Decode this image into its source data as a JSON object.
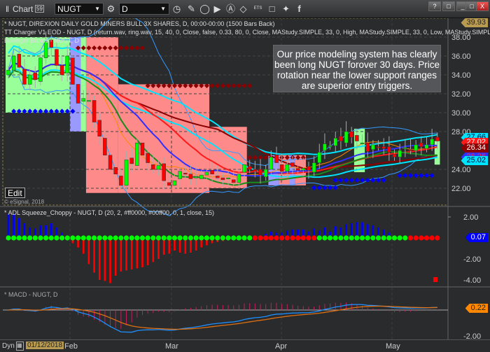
{
  "toolbar": {
    "title": "Chart",
    "symbol": "NUGT",
    "interval": "D",
    "window_buttons": [
      "?",
      "□",
      "_",
      "□",
      "X"
    ],
    "icons": [
      "link-icon",
      "settings-icon",
      "clock-icon",
      "pencil-icon",
      "draw-icon",
      "play-icon",
      "alert-icon",
      "tag-icon",
      "ets-icon",
      "comment-icon",
      "twitter-icon",
      "facebook-icon"
    ],
    "ets": "ETS"
  },
  "price_pane": {
    "line1": "* NUGT, DIREXION DAILY GOLD MINERS BULL 3X SHARES, D, 00:00-00:00 (1500 Bars Back)",
    "line2": "TT Charger V1 EOD - NUGT, D (return.wav, ring.wav, 15, 40, 0, Close, false, 0.33, 80, 0, Close, MAStudy.SIMPLE, 33, 0, High, MAStudy.SIMPLE, 33, 0, Low, MAStudy.SIMPLE, 14",
    "line3": "Bollinger Bands - NUGT, D",
    "note": "Our price modeling system has clearly been long NUGT forover 30 days. Price rotation near the lower support ranges are superior entry triggers.",
    "edit": "Edit",
    "copyright": "© eSignal, 2018",
    "axis": [
      "38.00",
      "36.00",
      "34.00",
      "32.00",
      "30.00",
      "28.00",
      "24.00",
      "22.00"
    ],
    "tags": [
      {
        "v": "39.93",
        "bg": "#b89a50",
        "fg": "#222"
      },
      {
        "v": "27.66",
        "bg": "#00e5ff",
        "fg": "#003"
      },
      {
        "v": "27.02",
        "bg": "#ff1a1a",
        "fg": "#fff"
      },
      {
        "v": "26.34",
        "bg": "#8b0000",
        "fg": "#fff"
      },
      {
        "v": "26.26",
        "bg": "#3030ff",
        "fg": "#f33"
      },
      {
        "v": "25.02",
        "bg": "#00e5ff",
        "fg": "#003"
      }
    ]
  },
  "squeeze_pane": {
    "title": "* ADL Squeeze_Choppy - NUGT, D (20, 2, #ff0000, #00ff00, 0, 1, close, 15)",
    "axis": [
      "2.00",
      "-2.00",
      "-4.00"
    ],
    "tag": "0.07"
  },
  "macd_pane": {
    "title": "* MACD - NUGT, D",
    "axis": [
      "-2.00"
    ],
    "tag": "0.22"
  },
  "bottom": {
    "dyn": "Dyn",
    "date": "01/12/2018",
    "months": [
      "Feb",
      "Mar",
      "Apr",
      "May"
    ]
  },
  "colors": {
    "up": "#00ff00",
    "down": "#ff0000",
    "bg": "#2a2b2d"
  },
  "chart_data": {
    "type": "candlestick",
    "symbol": "NUGT",
    "ylim": [
      21,
      40
    ],
    "closes": [
      34.5,
      36,
      34.8,
      33,
      34,
      33.5,
      35.8,
      37.5,
      36.9,
      35,
      34,
      36,
      33,
      31,
      31.5,
      31.3,
      29,
      27.5,
      25.5,
      24,
      23.5,
      22.3,
      25,
      24.6,
      26.8,
      25.5,
      24.7,
      24,
      24.4,
      22.8,
      22.3,
      22.8,
      23.8,
      23.5,
      23,
      23.2,
      23.4,
      23.7,
      23.5,
      23.1,
      22.9,
      23.1,
      22.6,
      23.5,
      24.5,
      24,
      23.8,
      23.4,
      24,
      25.3,
      24.7,
      23.8,
      24.5,
      24.3,
      23.9,
      24.1,
      23.9,
      24.7,
      25.8,
      26.7,
      26.5,
      27.3,
      27.0,
      28.0,
      27.4,
      27.0,
      26.8,
      25.9,
      26.6,
      26.4,
      26.2,
      25.8,
      25.3,
      26.0,
      26.3,
      26.0,
      26.6,
      26.4,
      26.6,
      27.2,
      27.0
    ],
    "zones": [
      {
        "from": 0,
        "to": 12,
        "color": "#99ff99",
        "top": 38,
        "bottom": 30
      },
      {
        "from": 12,
        "to": 14,
        "color": "#9999ff",
        "top": 38,
        "bottom": 28
      },
      {
        "from": 14,
        "to": 15,
        "color": "#99ff99",
        "top": 38,
        "bottom": 28
      },
      {
        "from": 15,
        "to": 21,
        "color": "#ff8a8a",
        "top": 38,
        "bottom": 21.5
      },
      {
        "from": 21,
        "to": 38,
        "color": "#ff8a8a",
        "top": 33,
        "bottom": 21.5
      },
      {
        "from": 38,
        "to": 45,
        "color": "#ff8a8a",
        "top": 28.5,
        "bottom": 22
      },
      {
        "from": 49,
        "to": 51,
        "color": "#9999ff",
        "top": 25.5,
        "bottom": 22.3
      },
      {
        "from": 51,
        "to": 53,
        "color": "#ff8a8a",
        "top": 25.5,
        "bottom": 22.3
      },
      {
        "from": 53,
        "to": 54,
        "color": "#9999ff",
        "top": 25.5,
        "bottom": 22.3
      },
      {
        "from": 54,
        "to": 56,
        "color": "#ff8a8a",
        "top": 25.5,
        "bottom": 22.3
      },
      {
        "from": 65,
        "to": 67,
        "color": "#99ff99",
        "top": 28.3,
        "bottom": 23.7
      },
      {
        "from": 80,
        "to": 81,
        "color": "#99ff99",
        "top": 27,
        "bottom": 24.5
      }
    ],
    "squeeze": [
      2.3,
      2.3,
      1.9,
      1.4,
      1.0,
      0.9,
      1.2,
      1.2,
      1.4,
      1.0,
      0.5,
      0.2,
      -0.5,
      -0.9,
      -1.5,
      -2.5,
      -3.3,
      -4.0,
      -4.1,
      -4.3,
      -3.6,
      -3.2,
      -3.1,
      -3.0,
      -2.9,
      -2.8,
      -2.6,
      -2.3,
      -2.0,
      -1.6,
      -1.5,
      -1.2,
      -1.4,
      -1.5,
      -1.4,
      -1.2,
      -0.9,
      -0.7,
      -0.5,
      -0.4,
      -0.3,
      -0.2,
      0,
      0,
      0,
      0,
      0,
      0,
      0.4,
      0.6,
      0.5,
      0.5,
      0.7,
      0.8,
      0.8,
      0.8,
      0.6,
      0.9,
      0.7,
      1.0,
      0.6,
      1.1,
      1.0,
      1.3,
      1.4,
      1.5,
      1.5,
      1.3,
      1.2,
      1.0,
      0.8,
      0.5,
      0.2,
      0.1,
      0.05,
      0.05,
      0.05,
      0.05,
      0.05,
      0.07,
      0.07
    ],
    "squeeze_dot_colors": [
      "green",
      45,
      "red",
      57,
      "green",
      74,
      "red",
      81
    ]
  }
}
